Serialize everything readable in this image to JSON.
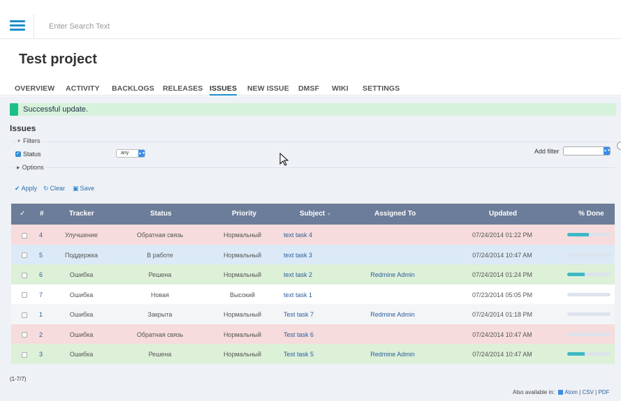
{
  "header": {
    "search_placeholder": "Enter Search Text"
  },
  "project": {
    "title": "Test project"
  },
  "tabs": [
    {
      "label": "OVERVIEW",
      "active": false
    },
    {
      "label": "ACTIVITY",
      "active": false
    },
    {
      "label": "BACKLOGS",
      "active": false
    },
    {
      "label": "RELEASES",
      "active": false
    },
    {
      "label": "ISSUES",
      "active": true
    },
    {
      "label": "NEW ISSUE",
      "active": false
    },
    {
      "label": "DMSF",
      "active": false
    },
    {
      "label": "WIKI",
      "active": false
    },
    {
      "label": "SETTINGS",
      "active": false
    }
  ],
  "flash": {
    "message": "Successful update.",
    "color": "#1cbf87"
  },
  "issues": {
    "heading": "Issues",
    "filters_legend": "Filters",
    "options_legend": "Options",
    "status_label": "Status",
    "status_value": "any",
    "add_filter_label": "Add filter",
    "actions": {
      "apply": "Apply",
      "clear": "Clear",
      "save": "Save"
    },
    "columns": [
      "✓",
      "#",
      "Tracker",
      "Status",
      "Priority",
      "Subject",
      "Assigned To",
      "Updated",
      "% Done"
    ],
    "rows": [
      {
        "id": "4",
        "tracker": "Улучшение",
        "status": "Обратная связь",
        "priority": "Нормальный",
        "subject": "text task 4",
        "assigned": "",
        "updated": "07/24/2014 01:22 PM",
        "done": 50,
        "color": "pink"
      },
      {
        "id": "5",
        "tracker": "Поддержка",
        "status": "В работе",
        "priority": "Нормальный",
        "subject": "text task 3",
        "assigned": "",
        "updated": "07/24/2014 10:47 AM",
        "done": 0,
        "color": "blue"
      },
      {
        "id": "6",
        "tracker": "Ошибка",
        "status": "Решена",
        "priority": "Нормальный",
        "subject": "text task 2",
        "assigned": "Redmine Admin",
        "updated": "07/24/2014 01:24 PM",
        "done": 40,
        "color": "green"
      },
      {
        "id": "7",
        "tracker": "Ошибка",
        "status": "Новая",
        "priority": "Высокий",
        "subject": "text task 1",
        "assigned": "",
        "updated": "07/23/2014 05:05 PM",
        "done": 0,
        "color": "white"
      },
      {
        "id": "1",
        "tracker": "Ошибка",
        "status": "Закрыта",
        "priority": "Нормальный",
        "subject": "Test task 7",
        "assigned": "Redmine Admin",
        "updated": "07/24/2014 01:18 PM",
        "done": 0,
        "color": "grey"
      },
      {
        "id": "2",
        "tracker": "Ошибка",
        "status": "Обратная связь",
        "priority": "Нормальный",
        "subject": "Test task 6",
        "assigned": "",
        "updated": "07/24/2014 10:47 AM",
        "done": 0,
        "color": "pink"
      },
      {
        "id": "3",
        "tracker": "Ошибка",
        "status": "Решена",
        "priority": "Нормальный",
        "subject": "Test task 5",
        "assigned": "Redmine Admin",
        "updated": "07/24/2014 10:47 AM",
        "done": 40,
        "color": "green"
      }
    ],
    "pager": "(1-7/7)",
    "also_available": "Also available in:",
    "formats": [
      "Atom",
      "CSV",
      "PDF"
    ]
  }
}
